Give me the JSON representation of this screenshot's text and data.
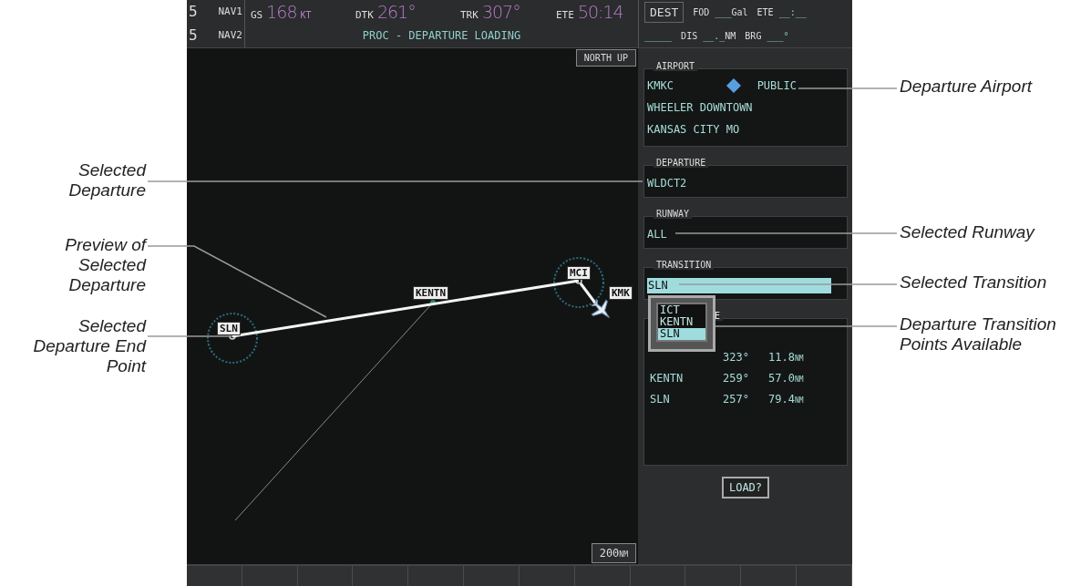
{
  "top_bar": {
    "com_digits": [
      "5",
      "5"
    ],
    "nav_labels": [
      "NAV1",
      "NAV2"
    ],
    "fields": [
      {
        "label": "GS",
        "value": "168",
        "unit": "KT"
      },
      {
        "label": "DTK",
        "value": "261°"
      },
      {
        "label": "TRK",
        "value": "307°"
      },
      {
        "label": "ETE",
        "value": "50:14"
      }
    ],
    "message": "PROC - DEPARTURE LOADING",
    "dest": {
      "label": "DEST",
      "first_line": [
        {
          "label": "FOD",
          "value": "___",
          "unit": "Gal"
        },
        {
          "label": "ETE",
          "value": "__:__"
        }
      ],
      "second_line": [
        {
          "value": "_____"
        },
        {
          "label": "DIS",
          "value": "__._",
          "unit": "NM"
        },
        {
          "label": "BRG",
          "value": "___°"
        }
      ]
    }
  },
  "map": {
    "orientation": "NORTH UP",
    "scale": "200",
    "scale_unit": "NM",
    "waypoints": [
      {
        "label": "SLN",
        "kind": "endpoint"
      },
      {
        "label": "KENTN",
        "kind": "fix"
      },
      {
        "label": "MCI",
        "kind": "vor"
      },
      {
        "label": "KMK",
        "kind": "airport"
      }
    ]
  },
  "panel": {
    "airport": {
      "title": "AIRPORT",
      "ident": "KMKC",
      "type": "PUBLIC",
      "name": "WHEELER DOWNTOWN",
      "city": "KANSAS CITY MO"
    },
    "departure": {
      "title": "DEPARTURE",
      "value": "WLDCT2"
    },
    "runway": {
      "title": "RUNWAY",
      "value": "ALL"
    },
    "transition": {
      "title": "TRANSITION",
      "value": "SLN",
      "selected": true
    },
    "popup": [
      {
        "label": "ICT",
        "selected": false
      },
      {
        "label": "KENTN",
        "selected": false
      },
      {
        "label": "SLN",
        "selected": true
      }
    ],
    "sequence": {
      "title": "E",
      "rows": [
        {
          "course": "323°",
          "distance": "11.8",
          "unit": "NM"
        },
        {
          "name": "KENTN",
          "course": "259°",
          "distance": "57.0",
          "unit": "NM"
        },
        {
          "name": "SLN",
          "course": "257°",
          "distance": "79.4",
          "unit": "NM"
        }
      ]
    },
    "load_button": "LOAD?"
  },
  "left_callouts": [
    "Selected\nDeparture",
    "Preview of\nSelected\nDeparture",
    "Selected\nDeparture End\nPoint"
  ],
  "right_callouts": [
    "Departure Airport",
    "Selected Runway",
    "Selected Transition",
    "Departure Transition\nPoints Available"
  ]
}
